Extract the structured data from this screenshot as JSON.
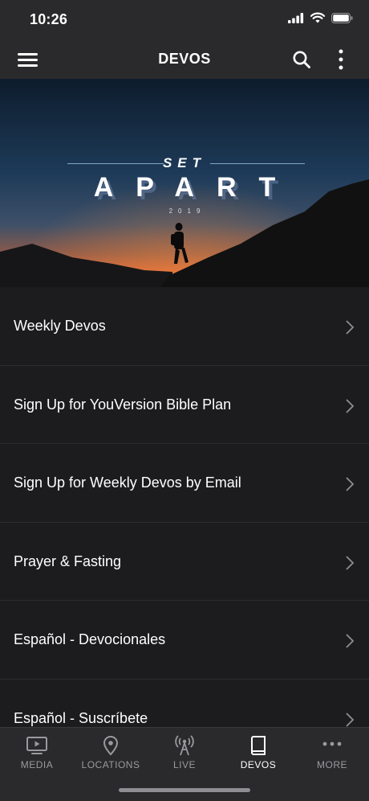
{
  "status_bar": {
    "time": "10:26"
  },
  "header": {
    "title": "DEVOS",
    "menu_icon": "hamburger-menu-icon",
    "search_icon": "search-icon",
    "more_icon": "kebab-menu-icon"
  },
  "hero": {
    "line1": "SET",
    "line2": "APART",
    "line3": "2019"
  },
  "list": {
    "items": [
      {
        "label": "Weekly Devos"
      },
      {
        "label": "Sign Up for YouVersion Bible Plan"
      },
      {
        "label": "Sign Up for Weekly Devos by Email"
      },
      {
        "label": "Prayer & Fasting"
      },
      {
        "label": "Español - Devocionales"
      },
      {
        "label": "Español - Suscríbete"
      }
    ]
  },
  "tab_bar": {
    "active": "DEVOS",
    "tabs": [
      {
        "label": "MEDIA",
        "icon": "tv-play-icon"
      },
      {
        "label": "LOCATIONS",
        "icon": "location-pin-icon"
      },
      {
        "label": "LIVE",
        "icon": "broadcast-tower-icon"
      },
      {
        "label": "DEVOS",
        "icon": "book-icon"
      },
      {
        "label": "MORE",
        "icon": "more-dots-icon"
      }
    ]
  },
  "colors": {
    "background": "#1c1c1e",
    "bar": "#2a2a2c",
    "inactive_tab": "#9a9a9e",
    "active_tab": "#ffffff"
  }
}
